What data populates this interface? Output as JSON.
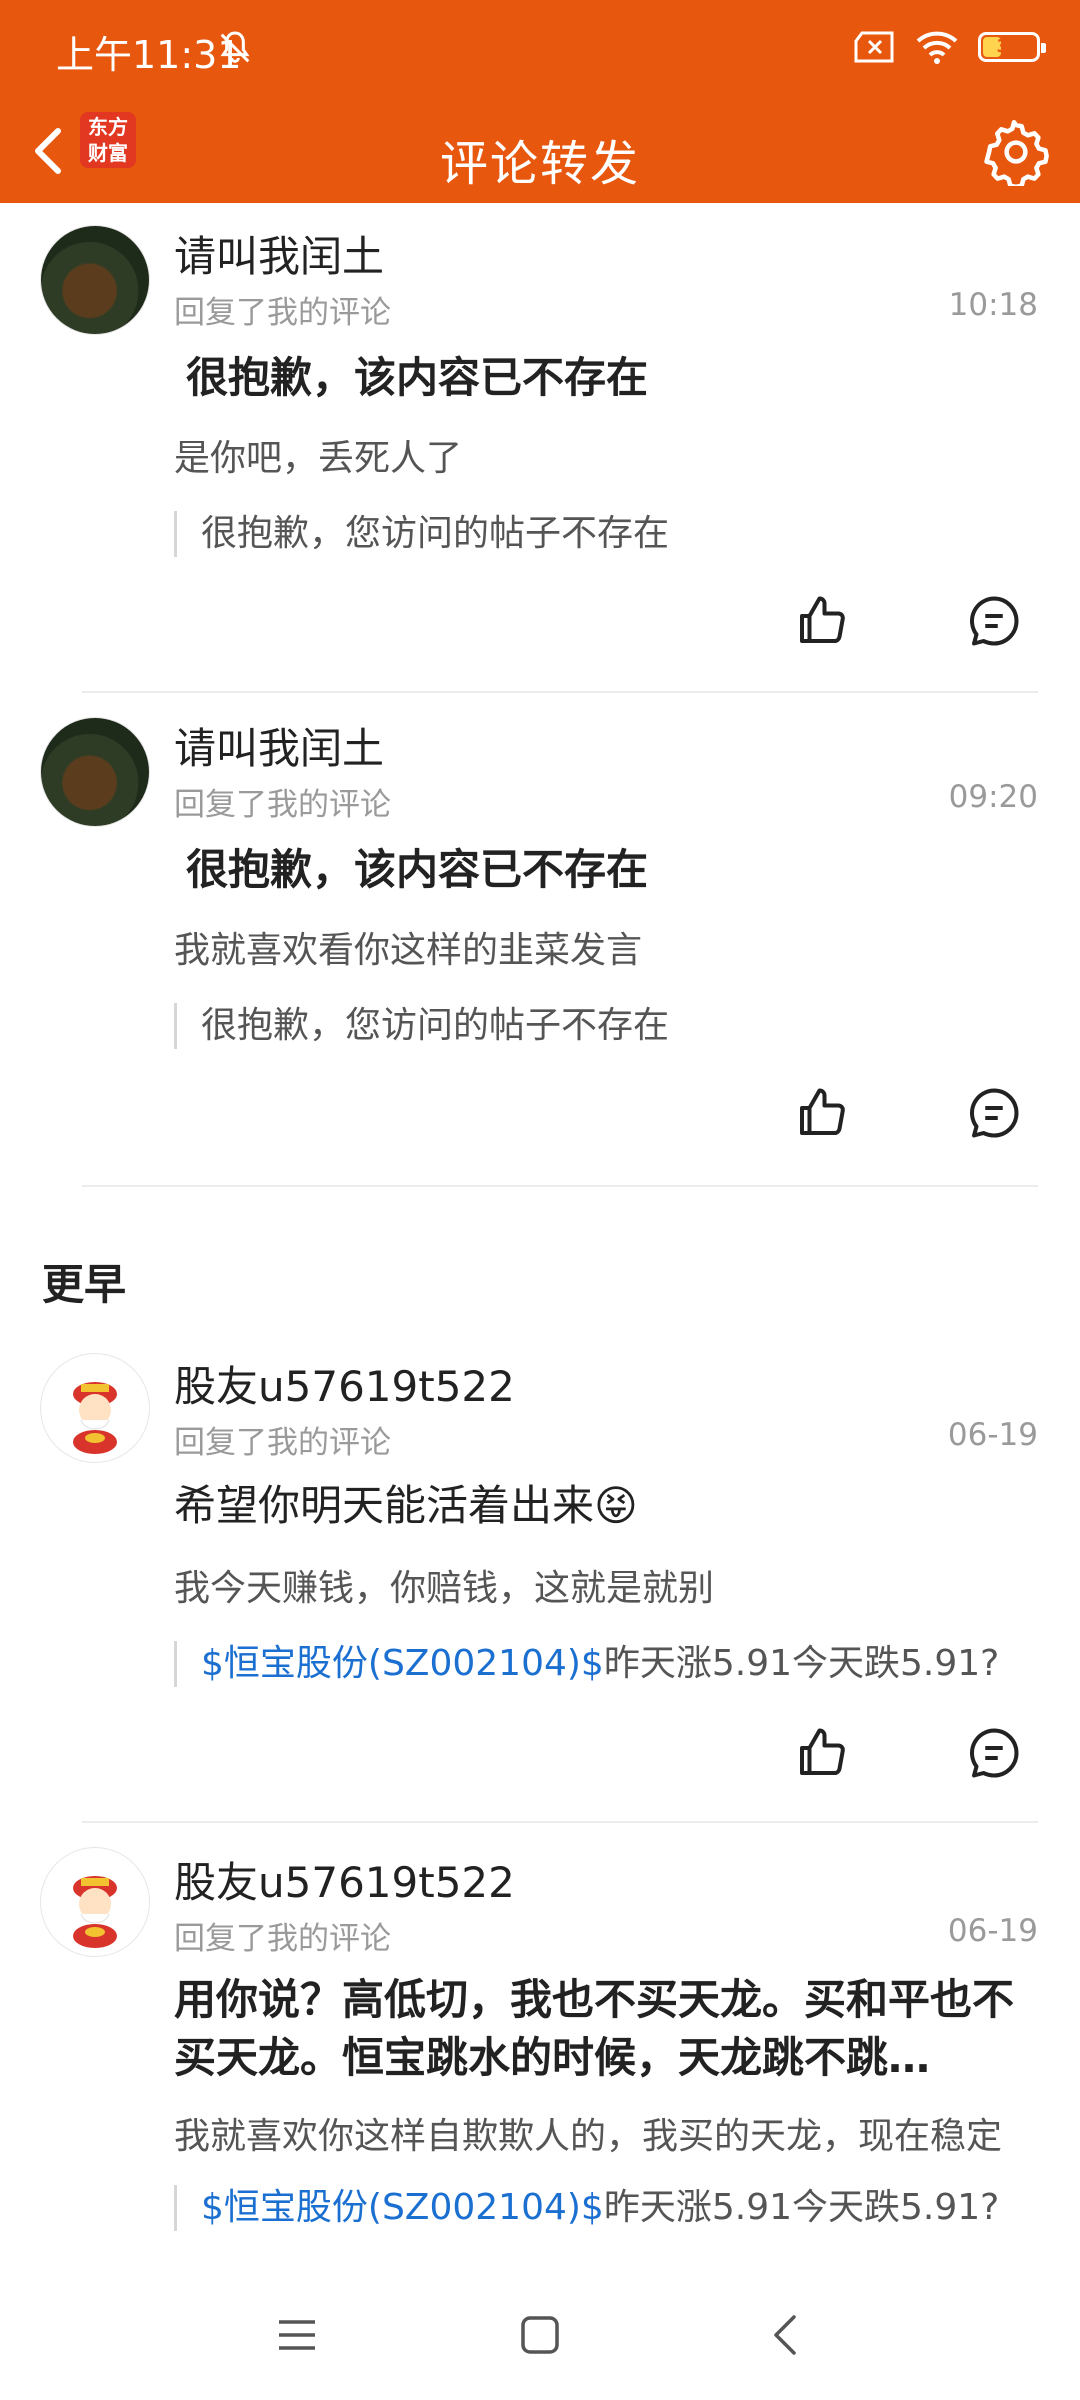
{
  "status": {
    "time": "上午11:31",
    "battery": "35"
  },
  "header": {
    "title": "评论转发",
    "logo_line1": "东方",
    "logo_line2": "财富"
  },
  "items": [
    {
      "username": "请叫我闰土",
      "subtitle": "回复了我的评论",
      "time": "10:18",
      "title": "很抱歉，该内容已不存在",
      "body": "是你吧，丢死人了",
      "quote": "很抱歉，您访问的帖子不存在"
    },
    {
      "username": "请叫我闰土",
      "subtitle": "回复了我的评论",
      "time": "09:20",
      "title": "很抱歉，该内容已不存在",
      "body": "我就喜欢看你这样的韭菜发言",
      "quote": "很抱歉，您访问的帖子不存在"
    }
  ],
  "section_title": "更早",
  "earlier": [
    {
      "username": "股友u57619t522",
      "subtitle": "回复了我的评论",
      "time": "06-19",
      "title": "希望你明天能活着出来😝",
      "body": "我今天赚钱，你赔钱，这就是就别",
      "quote_stock": "$恒宝股份(SZ002104)$",
      "quote_text": "昨天涨5.91今天跌5.91?"
    },
    {
      "username": "股友u57619t522",
      "subtitle": "回复了我的评论",
      "time": "06-19",
      "title": "用你说？高低切，我也不买天龙。买和平也不买天龙。恒宝跳水的时候，天龙跳不跳…",
      "body": "我就喜欢你这样自欺欺人的，我买的天龙，现在稳定",
      "quote_stock": "$恒宝股份(SZ002104)$",
      "quote_text": "昨天涨5.91今天跌5.91?"
    }
  ],
  "colors": {
    "brand": "#e8570e",
    "link": "#1a6fd0"
  },
  "icons": [
    "back-arrow-icon",
    "settings-gear-icon",
    "thumbs-up-icon",
    "comment-icon",
    "menu-icon",
    "home-square-icon",
    "back-chevron-icon"
  ]
}
